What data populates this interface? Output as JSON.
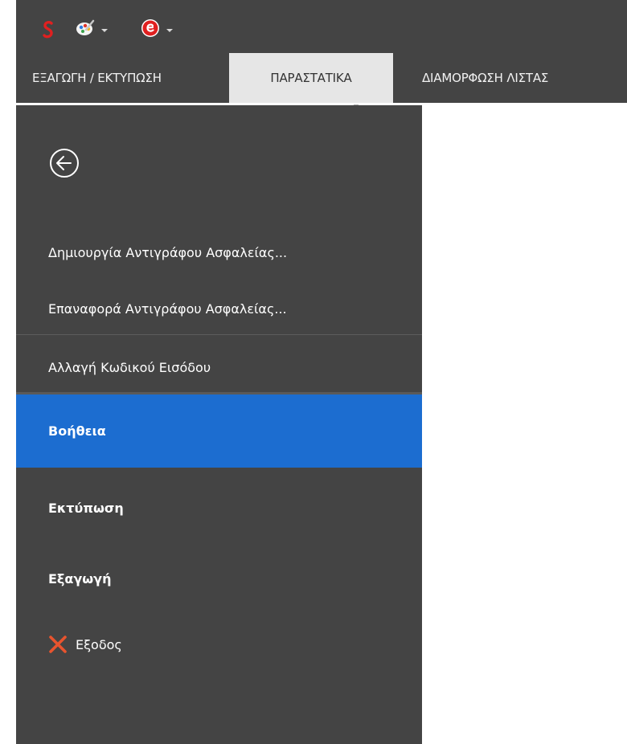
{
  "colors": {
    "chrome": "#444444",
    "active_tab": "#e6e6e6",
    "selected_item": "#1c6dd0",
    "exit_icon": "#e8542e",
    "brand_red": "#e02020"
  },
  "quick_access": {
    "logo_icon": "brand-s-logo-icon",
    "customize_icon": "paint-palette-icon",
    "app_icon": "red-e-circle-icon"
  },
  "tabs": [
    {
      "label": "ΕΞΑΓΩΓΗ / ΕΚΤΥΠΩΣΗ",
      "active": false
    },
    {
      "label": "ΠΑΡΑΣΤΑΤΙΚΑ",
      "active": true
    },
    {
      "label": "ΔΙΑΜΟΡΦΩΣΗ ΛΙΣΤΑΣ",
      "active": false
    }
  ],
  "backstage": {
    "back_icon": "back-arrow-circle-icon",
    "items": [
      {
        "label": "Δημιουργία Αντιγράφου Ασφαλείας..."
      },
      {
        "label": "Επαναφορά Αντιγράφου Ασφαλείας..."
      },
      {
        "label": "Αλλαγή Κωδικού Εισόδου"
      },
      {
        "label": "Βοήθεια",
        "selected": true
      },
      {
        "label": "Εκτύπωση"
      },
      {
        "label": "Εξαγωγή"
      },
      {
        "label": "Εξοδος",
        "icon": "close-x-icon"
      }
    ]
  }
}
